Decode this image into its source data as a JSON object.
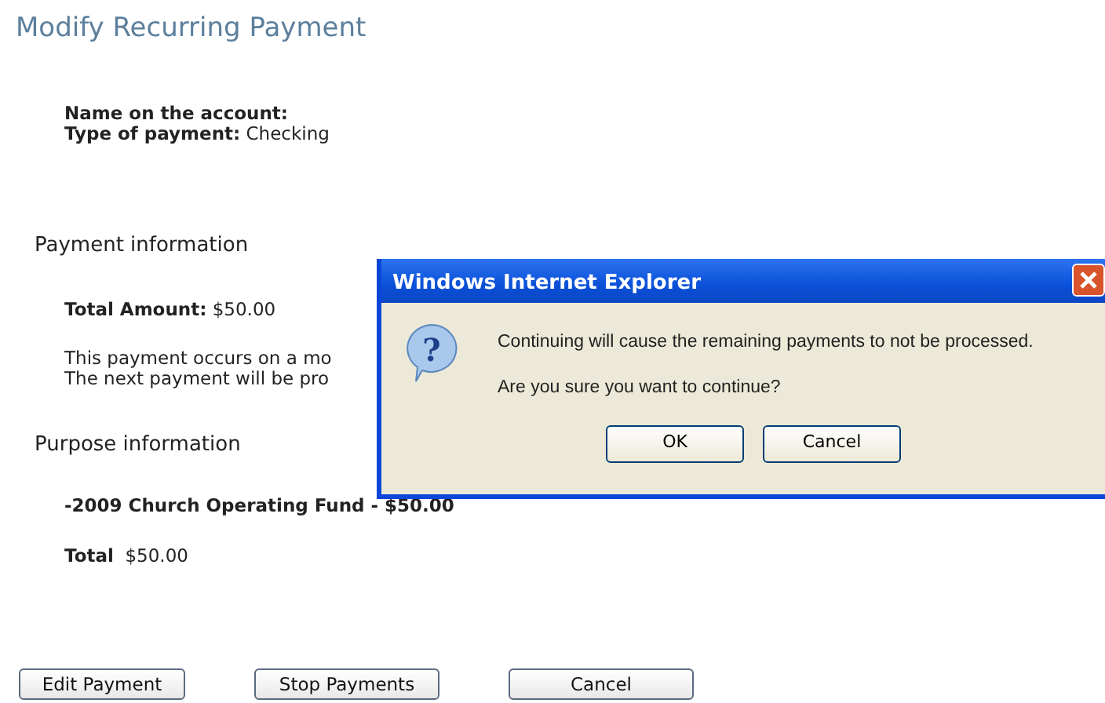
{
  "page": {
    "title": "Modify Recurring Payment",
    "account": [
      {
        "label": "Name on the account:"
      },
      {
        "label": "Type of payment:",
        "value": "Checking"
      }
    ],
    "payment_section": {
      "heading": "Payment information",
      "total_label": "Total Amount:",
      "total_value": "$50.00",
      "notes": [
        "This payment occurs on a mo",
        "The next payment will be pro"
      ]
    },
    "purpose_section": {
      "heading": "Purpose information",
      "fund": "-2009 Church Operating Fund - $50.00",
      "total_label": "Total",
      "total_value": "$50.00"
    },
    "buttons": [
      "Edit Payment",
      "Stop Payments",
      "Cancel"
    ]
  },
  "dialog": {
    "title": "Windows Internet Explorer",
    "icon": "?",
    "message": "Continuing will cause the remaining payments to not be processed.",
    "question": "Are you sure you want to continue?",
    "buttons": [
      "OK",
      "Cancel"
    ]
  }
}
